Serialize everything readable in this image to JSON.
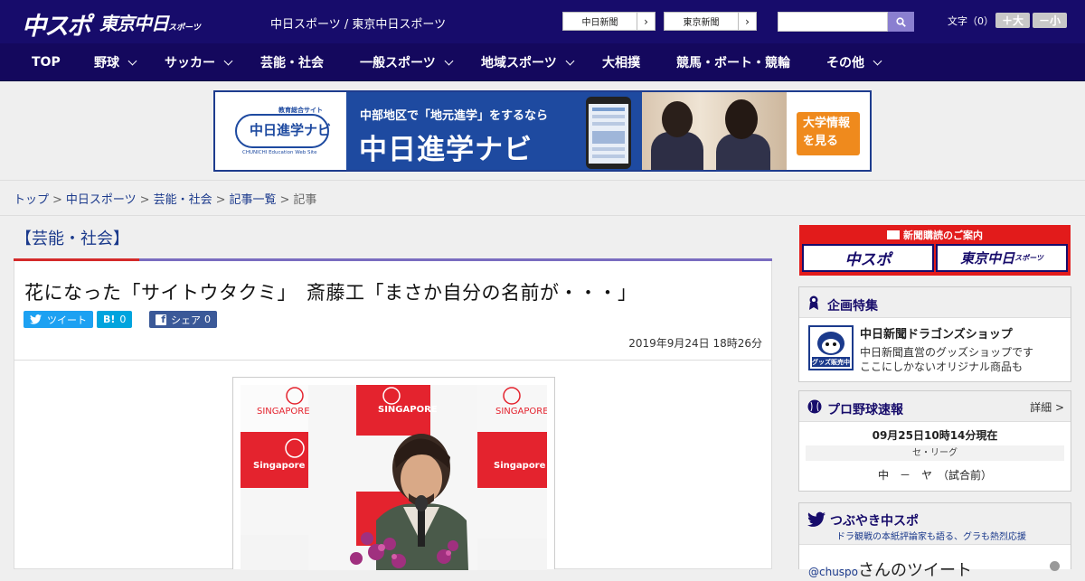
{
  "header": {
    "logo_main": "中スポ",
    "logo_tokyo": "東京中日",
    "logo_tokyo_suffix": "スポーツ",
    "site_name": "中日スポーツ / 東京中日スポーツ",
    "newspaper_link_1": "中日新聞",
    "newspaper_link_2": "東京新聞",
    "search_placeholder": "",
    "font_size_label": "文字（0）",
    "font_larger": "＋大",
    "font_smaller": "－小"
  },
  "nav": {
    "items": [
      {
        "label": "TOP"
      },
      {
        "label": "野球"
      },
      {
        "label": "サッカー"
      },
      {
        "label": "芸能・社会"
      },
      {
        "label": "一般スポーツ"
      },
      {
        "label": "地域スポーツ"
      },
      {
        "label": "大相撲"
      },
      {
        "label": "競馬・ボート・競輪"
      },
      {
        "label": "その他"
      }
    ]
  },
  "banner": {
    "logo_kicker": "教育総合サイト",
    "logo_name": "中日進学ナビ",
    "logo_sub": "CHUNICHI Education Web Site",
    "headline_small": "中部地区で「地元進学」をするなら",
    "headline_big": "中日進学ナビ",
    "cta": "大学情報を見る"
  },
  "breadcrumb": {
    "items": [
      "トップ",
      "中日スポーツ",
      "芸能・社会",
      "記事一覧"
    ],
    "current": "記事",
    "separator": ">"
  },
  "article": {
    "category": "【芸能・社会】",
    "title": "花になった「サイトウタクミ」　斎藤工「まさか自分の名前が・・・」",
    "share": {
      "tweet": "ツイート",
      "hatena_glyph": "B!",
      "hatena_count": "0",
      "facebook_glyph": "f",
      "facebook_label": "シェア",
      "facebook_count": "0"
    },
    "date": "2019年9月24日 18時26分"
  },
  "sidebar": {
    "subscribe_title": "新聞購読のご案内",
    "subscribe_btn_1": "中スポ",
    "subscribe_btn_2": "東京中日",
    "subscribe_btn_2_suffix": "スポーツ",
    "features_title": "企画特集",
    "shop_title": "中日新聞ドラゴンズショップ",
    "shop_desc_1": "中日新聞直営のグッズショップです",
    "shop_desc_2": "ここにしかないオリジナル商品も",
    "shop_badge": "グッズ販売中",
    "baseball_title": "プロ野球速報",
    "baseball_detail": "詳細 >",
    "baseball_time": "09月25日10時14分現在",
    "baseball_league": "セ・リーグ",
    "baseball_game": "中　－　ヤ　（試合前）",
    "tweets_title": "つぶやき中スポ",
    "tweets_sub": "ドラ観戦の本紙評論家も語る、グラも熱烈応援",
    "tweets_handle": "@chuspo",
    "tweets_label": "さんのツイート"
  },
  "colors": {
    "header_bg": "#170c6b",
    "nav_bg": "#14085d",
    "link": "#1b3a8c",
    "accent_red": "#d42a2a",
    "twitter": "#1da1f2",
    "hatena": "#00a4de",
    "facebook": "#3b5998"
  }
}
